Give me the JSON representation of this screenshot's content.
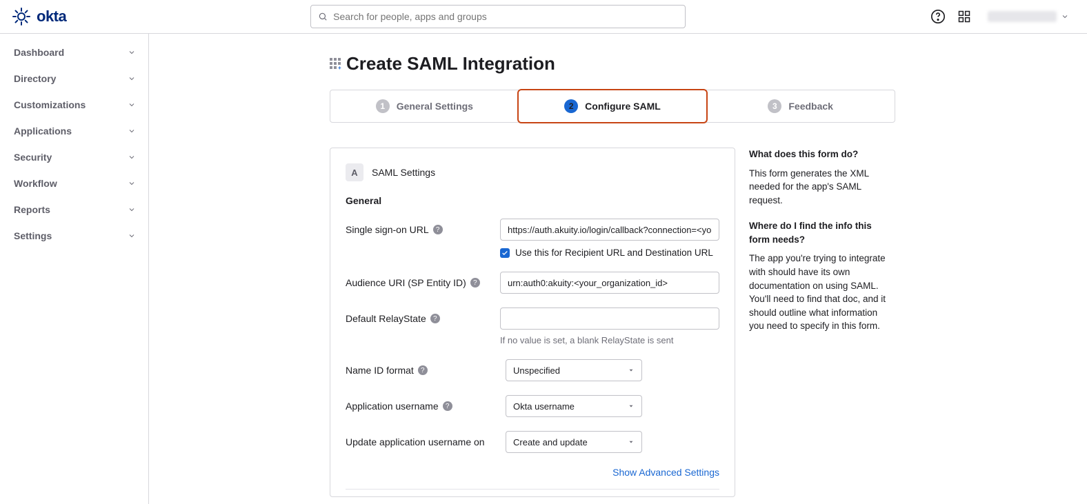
{
  "logo_text": "okta",
  "search": {
    "placeholder": "Search for people, apps and groups"
  },
  "user_menu_label": "",
  "sidebar": [
    {
      "label": "Dashboard"
    },
    {
      "label": "Directory"
    },
    {
      "label": "Customizations"
    },
    {
      "label": "Applications"
    },
    {
      "label": "Security"
    },
    {
      "label": "Workflow"
    },
    {
      "label": "Reports"
    },
    {
      "label": "Settings"
    }
  ],
  "page_title": "Create SAML Integration",
  "steps": [
    {
      "num": "1",
      "label": "General Settings"
    },
    {
      "num": "2",
      "label": "Configure SAML"
    },
    {
      "num": "3",
      "label": "Feedback"
    }
  ],
  "form": {
    "badge": "A",
    "card_title": "SAML Settings",
    "section": "General",
    "sso_url_label": "Single sign-on URL",
    "sso_url_value": "https://auth.akuity.io/login/callback?connection=<your_organization_id>",
    "sso_checkbox": "Use this for Recipient URL and Destination URL",
    "audience_label": "Audience URI (SP Entity ID)",
    "audience_value": "urn:auth0:akuity:<your_organization_id>",
    "relay_label": "Default RelayState",
    "relay_value": "",
    "relay_hint": "If no value is set, a blank RelayState is sent",
    "nameid_label": "Name ID format",
    "nameid_value": "Unspecified",
    "appuser_label": "Application username",
    "appuser_value": "Okta username",
    "update_label": "Update application username on",
    "update_value": "Create and update",
    "advanced_link": "Show Advanced Settings"
  },
  "help": {
    "h1": "What does this form do?",
    "p1": "This form generates the XML needed for the app's SAML request.",
    "h2": "Where do I find the info this form needs?",
    "p2": "The app you're trying to integrate with should have its own documentation on using SAML. You'll need to find that doc, and it should outline what information you need to specify in this form."
  }
}
